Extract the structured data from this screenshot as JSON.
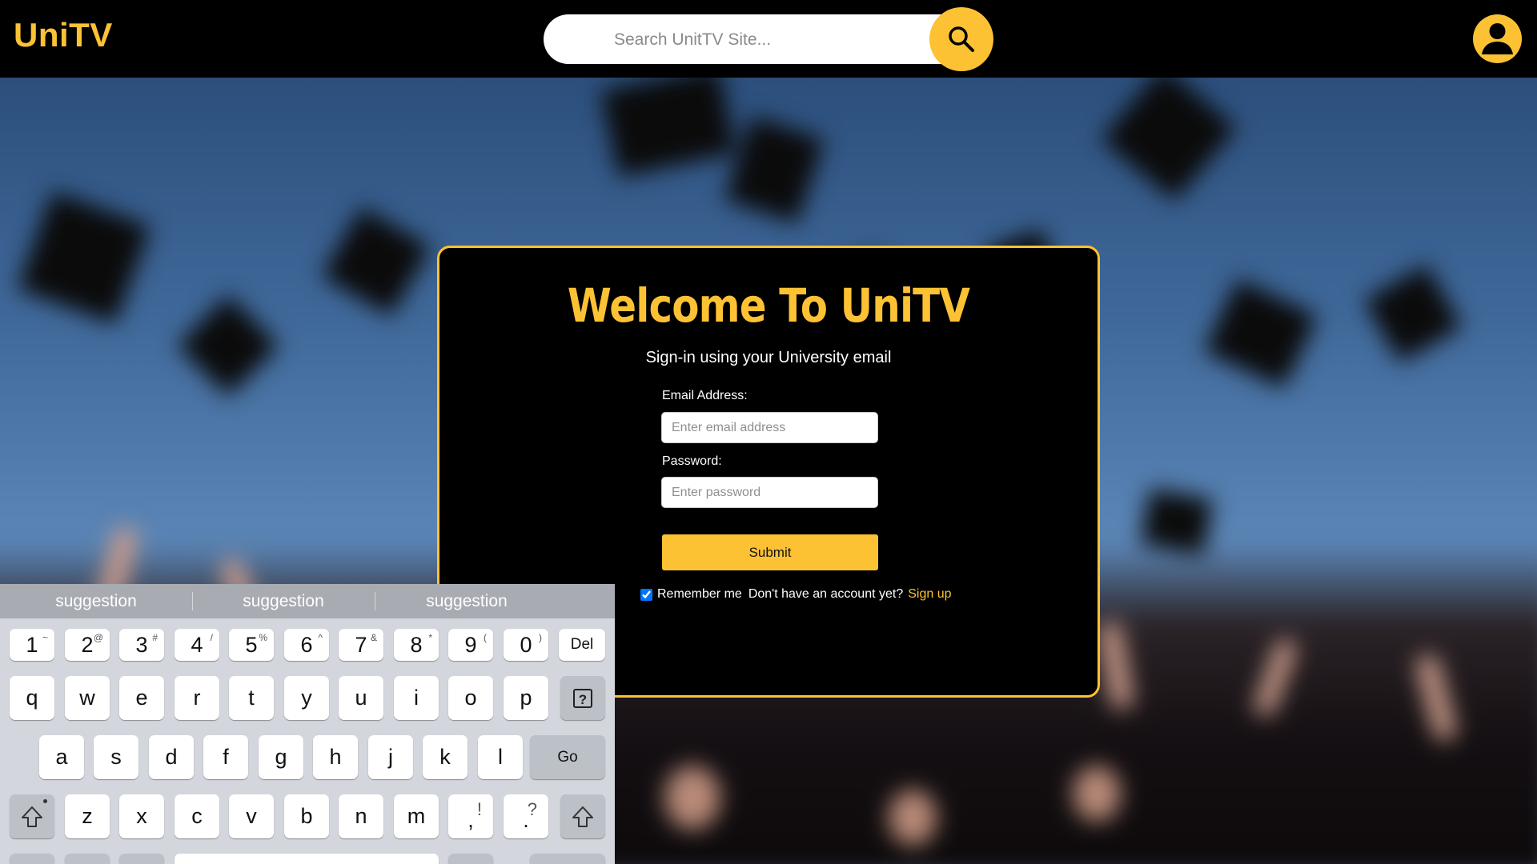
{
  "header": {
    "logo": "UniTV",
    "search_placeholder": "Search UnitTV Site..."
  },
  "card": {
    "title": "Welcome To UniTV",
    "subtitle": "Sign-in using your University email",
    "email_label": "Email Address:",
    "email_placeholder": "Enter email address",
    "password_label": "Password:",
    "password_placeholder": "Enter password",
    "submit_label": "Submit",
    "remember_label": "Remember me",
    "remember_checked": true,
    "no_account_text": "Don't have an account yet?",
    "signup_link": "Sign up"
  },
  "keyboard": {
    "suggestions": [
      "suggestion",
      "suggestion",
      "suggestion"
    ],
    "row_numbers": [
      {
        "main": "1",
        "sub": "~"
      },
      {
        "main": "2",
        "sub": "@"
      },
      {
        "main": "3",
        "sub": "#"
      },
      {
        "main": "4",
        "sub": "/"
      },
      {
        "main": "5",
        "sub": "%"
      },
      {
        "main": "6",
        "sub": "^"
      },
      {
        "main": "7",
        "sub": "&"
      },
      {
        "main": "8",
        "sub": "*"
      },
      {
        "main": "9",
        "sub": "("
      },
      {
        "main": "0",
        "sub": ")"
      }
    ],
    "del_label": "Del",
    "row_q": [
      "q",
      "w",
      "e",
      "r",
      "t",
      "y",
      "u",
      "i",
      "o",
      "p"
    ],
    "help_label": "?",
    "row_a": [
      "a",
      "s",
      "d",
      "f",
      "g",
      "h",
      "j",
      "k",
      "l"
    ],
    "go_label": "Go",
    "row_z": [
      "z",
      "x",
      "c",
      "v",
      "b",
      "n",
      "m"
    ],
    "punct_comma": {
      "main": ",",
      "sub": "!"
    },
    "punct_period": {
      "main": ".",
      "sub": "?"
    }
  },
  "colors": {
    "accent": "#fcc234",
    "header_bg": "#000000",
    "card_bg": "#000000",
    "keyboard_bg": "#d3d6dc"
  },
  "icons": {
    "search": "search-icon",
    "profile": "user-account-icon",
    "shift": "shift-icon",
    "help": "help-key-icon"
  }
}
